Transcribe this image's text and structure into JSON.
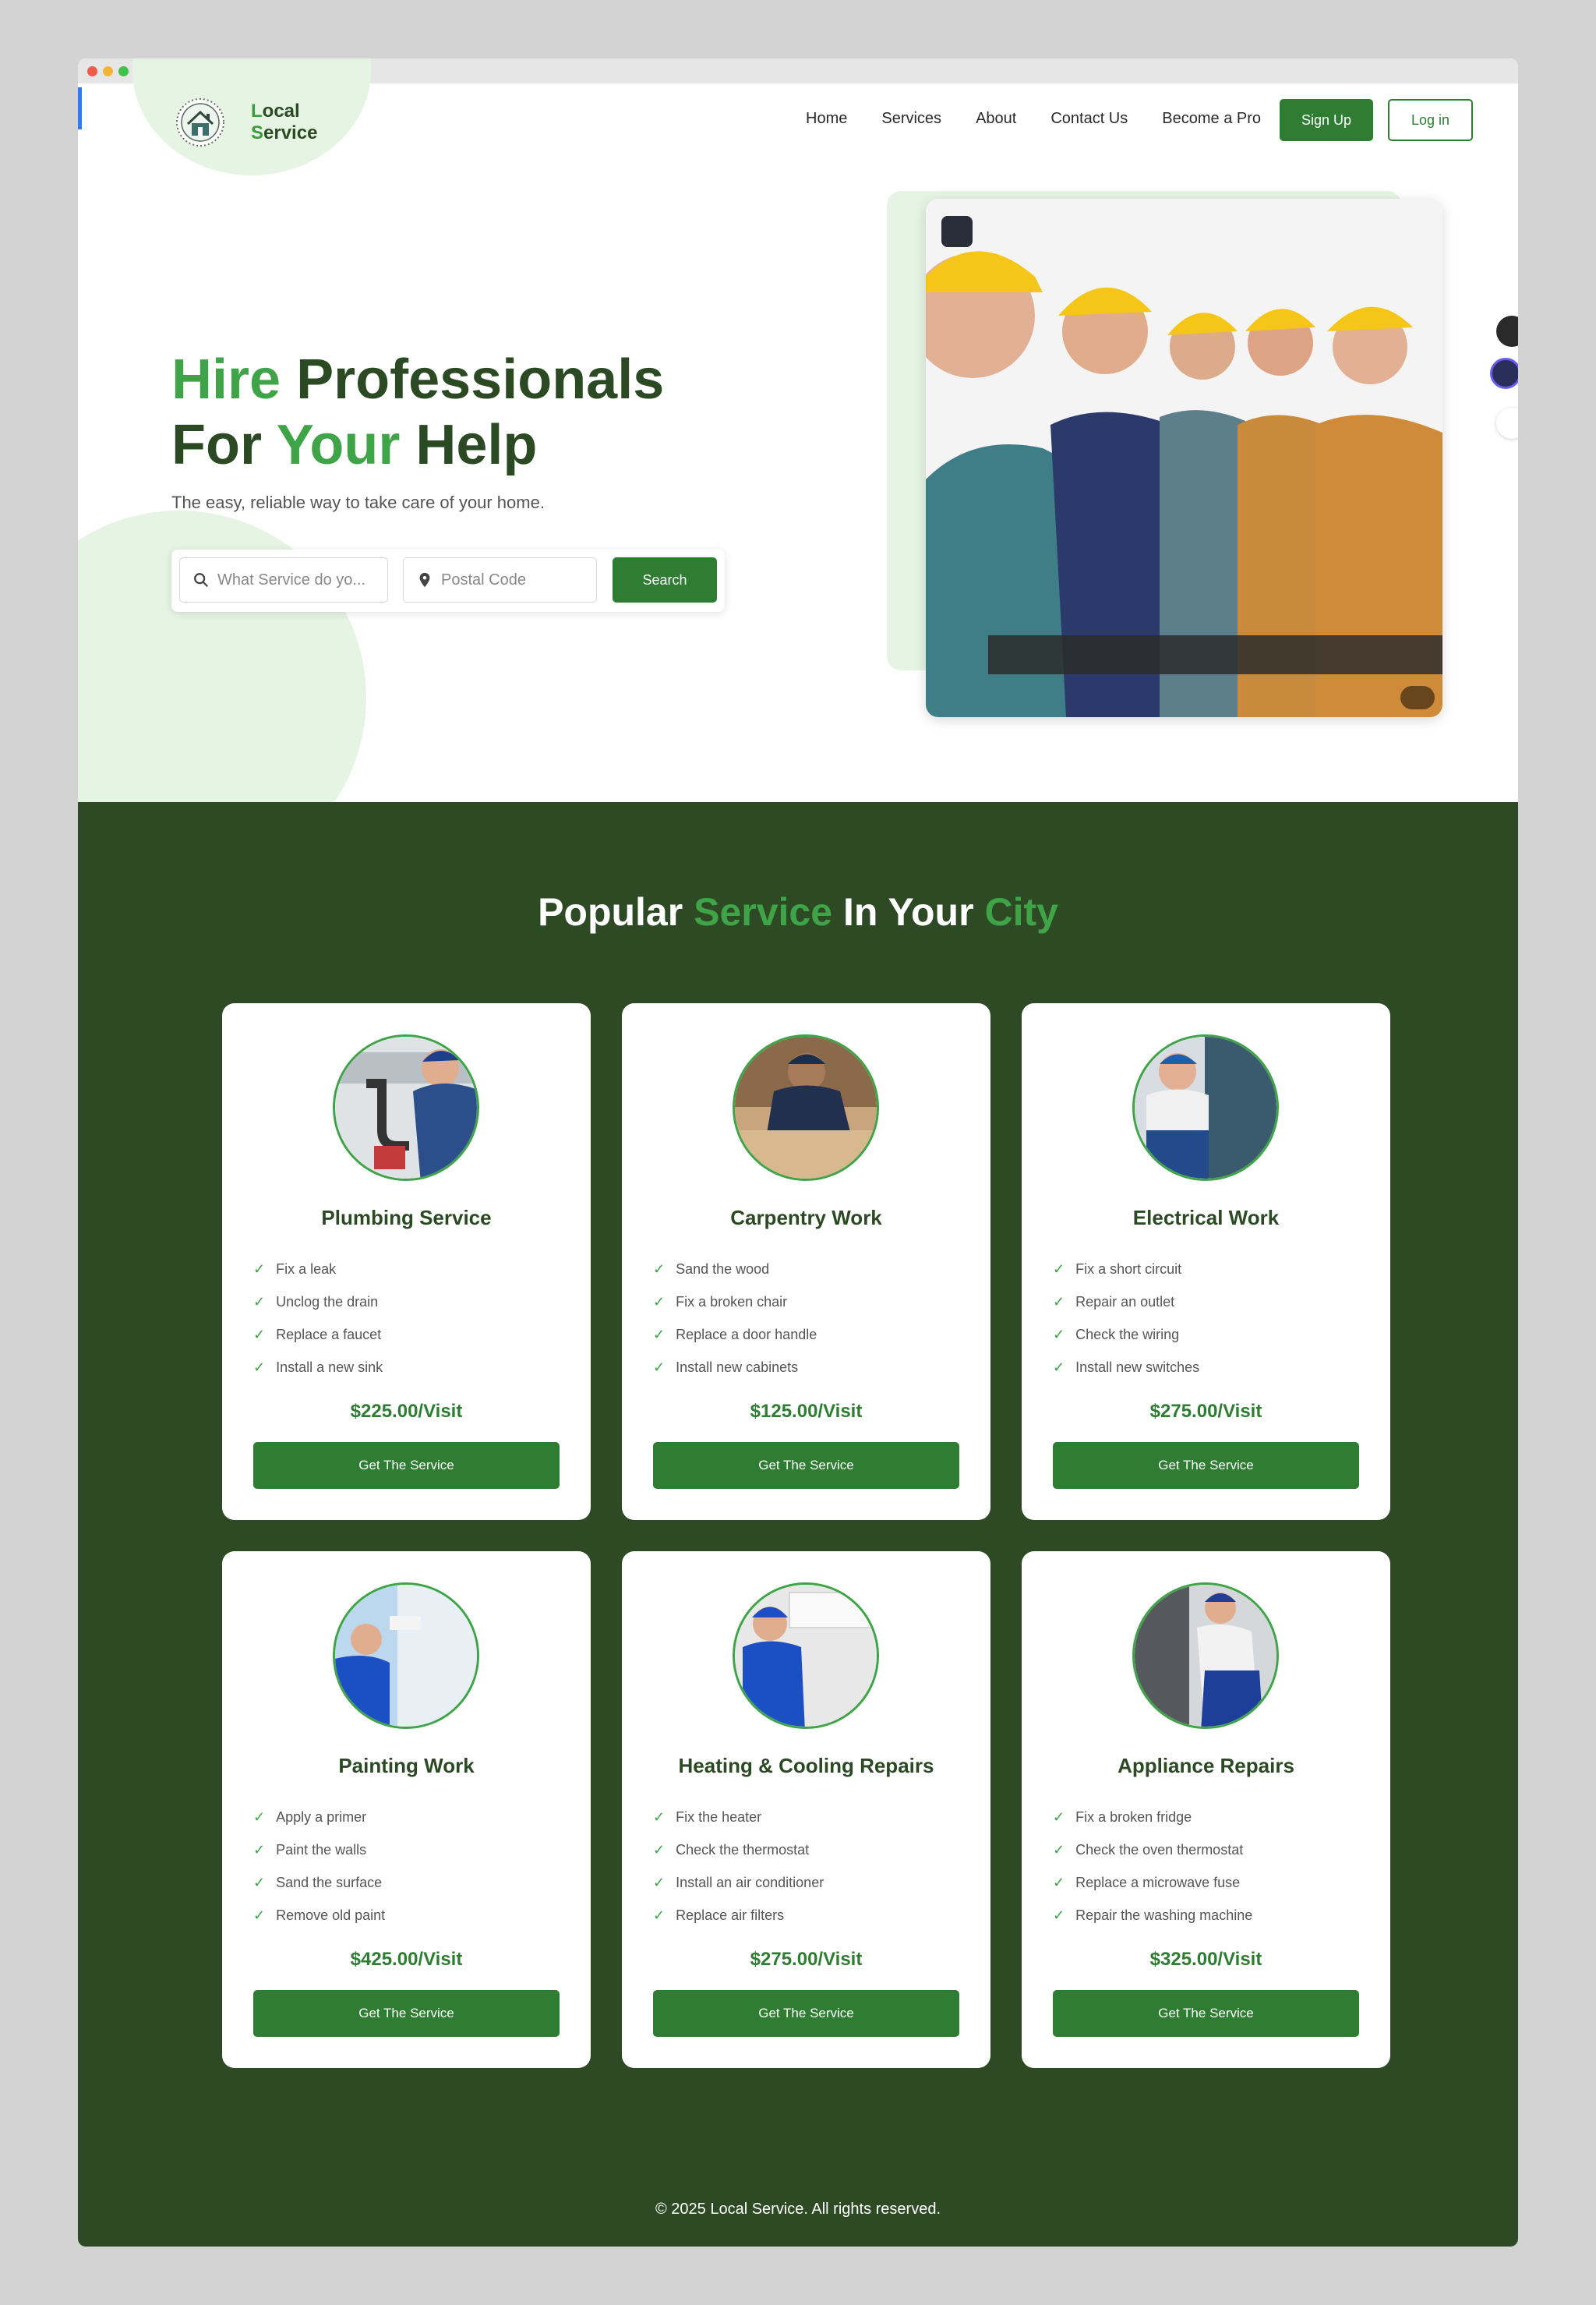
{
  "brand": {
    "line1_initial": "L",
    "line1_rest": "ocal",
    "line2_initial": "S",
    "line2_rest": "ervice"
  },
  "nav": {
    "items": [
      "Home",
      "Services",
      "About",
      "Contact Us",
      "Become a Pro"
    ],
    "signup": "Sign Up",
    "login": "Log in"
  },
  "hero": {
    "title_w1": "Hire",
    "title_w2": "Professionals",
    "title_w3": "For",
    "title_w4": "Your",
    "title_w5": "Help",
    "subtitle": "The easy, reliable way to take care of your home.",
    "service_placeholder": "What Service do yo...",
    "postal_placeholder": "Postal Code",
    "search_label": "Search"
  },
  "services": {
    "title_w1": "Popular",
    "title_w2": "Service",
    "title_w3": "In Your",
    "title_w4": "City",
    "button_label": "Get The Service",
    "cards": [
      {
        "name": "Plumbing Service",
        "items": [
          "Fix a leak",
          "Unclog the drain",
          "Replace a faucet",
          "Install a new sink"
        ],
        "price": "$225.00/Visit"
      },
      {
        "name": "Carpentry Work",
        "items": [
          "Sand the wood",
          "Fix a broken chair",
          "Replace a door handle",
          "Install new cabinets"
        ],
        "price": "$125.00/Visit"
      },
      {
        "name": "Electrical Work",
        "items": [
          "Fix a short circuit",
          "Repair an outlet",
          "Check the wiring",
          "Install new switches"
        ],
        "price": "$275.00/Visit"
      },
      {
        "name": "Painting Work",
        "items": [
          "Apply a primer",
          "Paint the walls",
          "Sand the surface",
          "Remove old paint"
        ],
        "price": "$425.00/Visit"
      },
      {
        "name": "Heating & Cooling Repairs",
        "items": [
          "Fix the heater",
          "Check the thermostat",
          "Install an air conditioner",
          "Replace air filters"
        ],
        "price": "$275.00/Visit"
      },
      {
        "name": "Appliance Repairs",
        "items": [
          "Fix a broken fridge",
          "Check the oven thermostat",
          "Replace a microwave fuse",
          "Repair the washing machine"
        ],
        "price": "$325.00/Visit"
      }
    ]
  },
  "footer": {
    "text": "© 2025 Local Service. All rights reserved."
  },
  "colors": {
    "primary": "#2e7d32",
    "accent": "#3fa448",
    "dark": "#2e4a25",
    "tint": "#e6f4e4"
  }
}
